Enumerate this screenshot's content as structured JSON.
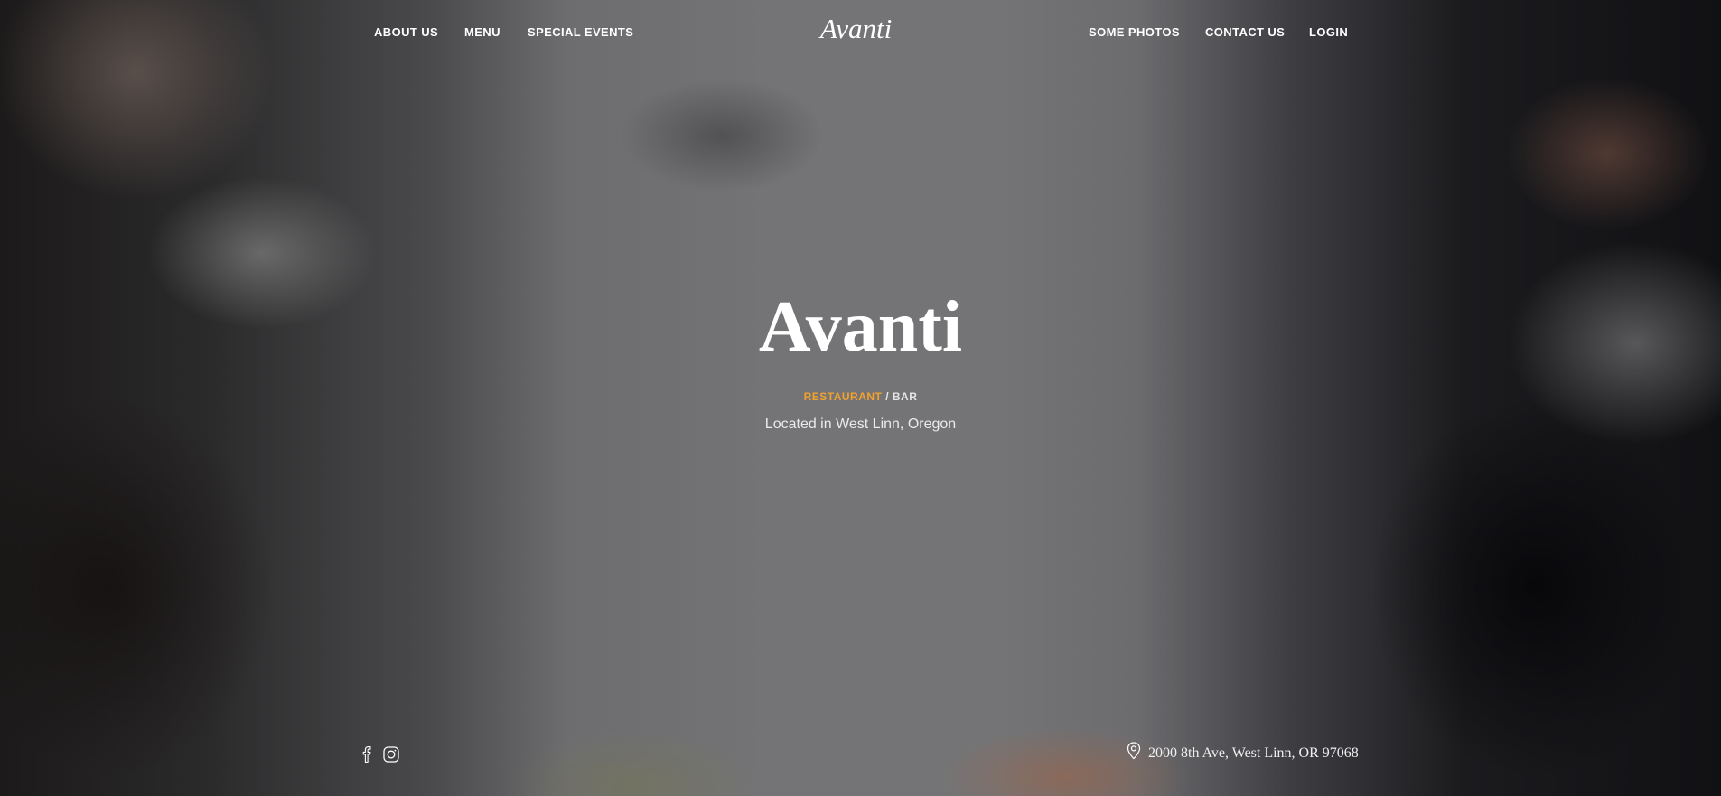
{
  "brand": {
    "logo_text": "Avanti"
  },
  "nav": {
    "left": [
      "ABOUT US",
      "MENU",
      "SPECIAL EVENTS"
    ],
    "right": [
      "SOME PHOTOS",
      "CONTACT US",
      "LOGIN"
    ]
  },
  "hero": {
    "title": "Avanti",
    "tagline_accent": "RESTAURANT",
    "tagline_rest": " / BAR",
    "location": "Located in West Linn, Oregon"
  },
  "footer": {
    "social_icons": [
      "facebook-icon",
      "instagram-icon"
    ],
    "address_icon": "map-pin-icon",
    "address": "2000 8th Ave, West Linn, OR 97068"
  },
  "colors": {
    "accent": "#f2a12e",
    "text": "#ffffff"
  }
}
